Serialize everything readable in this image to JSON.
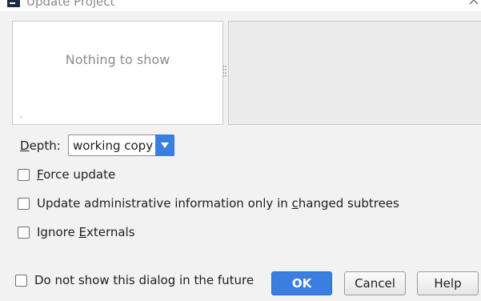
{
  "window": {
    "title": "Update Project"
  },
  "changes_list": {
    "empty_text": "Nothing to show"
  },
  "depth": {
    "label_prefix": "D",
    "label_rest": "epth:",
    "value": "working copy"
  },
  "options": [
    {
      "pre": "",
      "mnemonic": "F",
      "post": "orce update",
      "checked": false
    },
    {
      "pre": "Update administrative information only in ",
      "mnemonic": "c",
      "post": "hanged subtrees",
      "checked": false
    },
    {
      "pre": "Ignore ",
      "mnemonic": "E",
      "post": "xternals",
      "checked": false
    }
  ],
  "footer": {
    "dont_show": {
      "label": "Do not show this dialog in the future",
      "checked": false
    },
    "ok_label": "OK",
    "cancel_label": "Cancel",
    "help_label": "Help"
  },
  "colors": {
    "accent": "#3a7fe0",
    "background": "#f2f2f2"
  }
}
